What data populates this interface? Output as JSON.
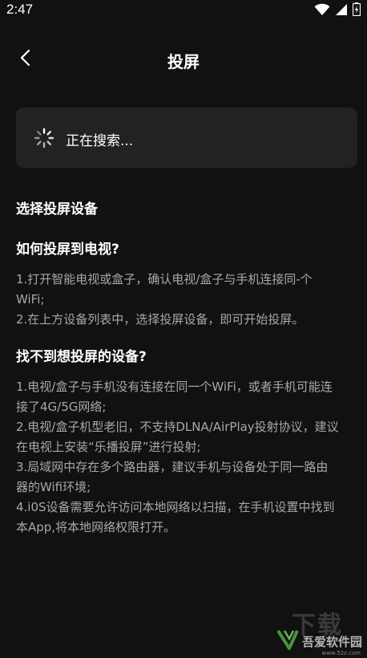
{
  "status_bar": {
    "time": "2:47",
    "icons": [
      "wifi-icon",
      "signal-icon",
      "battery-icon"
    ]
  },
  "header": {
    "title": "投屏",
    "back_icon": "chevron-left-icon"
  },
  "search": {
    "status_text": "正在搜索...",
    "icon": "spinner-icon"
  },
  "section": {
    "title": "选择投屏设备"
  },
  "how_to": {
    "heading": "如何投屏到电视?",
    "lines": [
      "1.打开智能电视或盒子，确认电视/盒子与手机连接同-个",
      "WiFi;",
      "2.在上方设备列表中，选择投屏设备，即可开始投屏。"
    ]
  },
  "not_found": {
    "heading": "找不到想投屏的设备?",
    "lines": [
      "1.电视/盒子与手机没有连接在同一个WiFi，或者手机可能连",
      "接了4G/5G网络;",
      "2.电视/盒子机型老旧，不支持DLNA/AirPlay投射协议，建议",
      "在电视上安装“乐播投屏”进行投射;",
      "3.局域网中存在多个路由器，建议手机与设备处于同一路由",
      "器的Wifi环境;",
      "4.i0S设备需要允许访问本地网络以扫描，在手机设置中找到",
      "本App,将本地网络权限打开。"
    ]
  },
  "watermark": {
    "text": "吾爱软件园",
    "url": "www.52z.com",
    "ghost": "下载"
  },
  "colors": {
    "background": "#111111",
    "card": "#222222",
    "body_text": "#a8a8a8",
    "title_text": "#ffffff"
  }
}
